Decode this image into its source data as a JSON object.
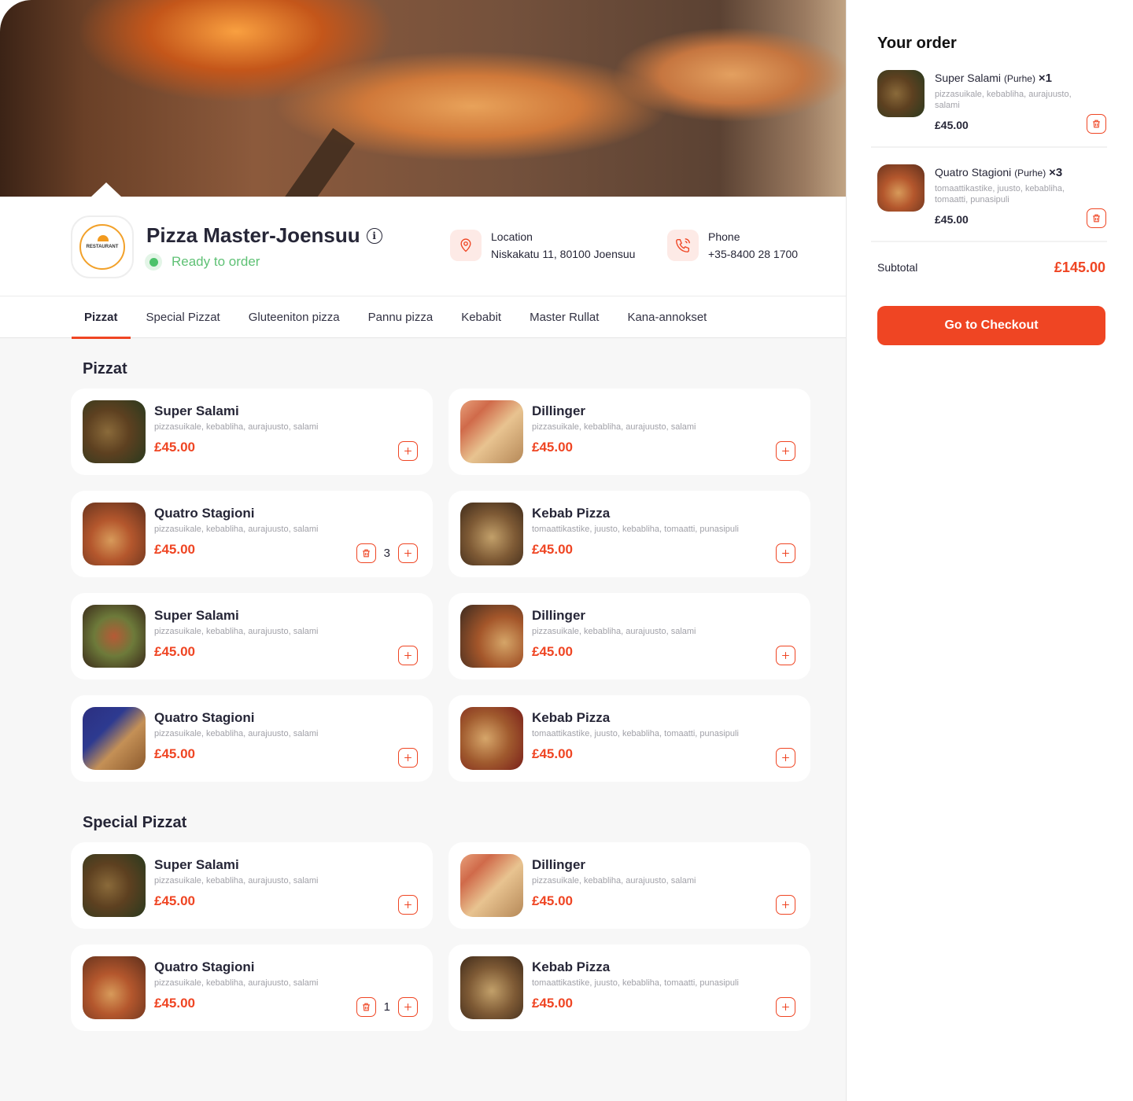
{
  "restaurant": {
    "name": "Pizza Master-Joensuu",
    "logo_text": "RESTAURANT",
    "status": "Ready to order",
    "location_label": "Location",
    "location_value": "Niskakatu 11, 80100 Joensuu",
    "phone_label": "Phone",
    "phone_value": "+35-8400  28  1700"
  },
  "tabs": [
    {
      "label": "Pizzat",
      "active": true
    },
    {
      "label": "Special Pizzat"
    },
    {
      "label": "Gluteeniton pizza"
    },
    {
      "label": "Pannu pizza"
    },
    {
      "label": "Kebabit"
    },
    {
      "label": "Master Rullat"
    },
    {
      "label": "Kana-annokset"
    }
  ],
  "sections": [
    {
      "title": "Pizzat",
      "items": [
        {
          "name": "Super Salami",
          "desc": "pizzasuikale, kebabliha, aurajuusto, salami",
          "price": "£45.00",
          "qty": null
        },
        {
          "name": "Dillinger",
          "desc": "pizzasuikale, kebabliha, aurajuusto, salami",
          "price": "£45.00",
          "qty": null
        },
        {
          "name": "Quatro Stagioni",
          "desc": "pizzasuikale, kebabliha, aurajuusto, salami",
          "price": "£45.00",
          "qty": "3"
        },
        {
          "name": "Kebab Pizza",
          "desc": "tomaattikastike, juusto, kebabliha, tomaatti, punasipuli",
          "price": "£45.00",
          "qty": null
        },
        {
          "name": "Super Salami",
          "desc": "pizzasuikale, kebabliha, aurajuusto, salami",
          "price": "£45.00",
          "qty": null
        },
        {
          "name": "Dillinger",
          "desc": "pizzasuikale, kebabliha, aurajuusto, salami",
          "price": "£45.00",
          "qty": null
        },
        {
          "name": "Quatro Stagioni",
          "desc": "pizzasuikale, kebabliha, aurajuusto, salami",
          "price": "£45.00",
          "qty": null
        },
        {
          "name": "Kebab Pizza",
          "desc": "tomaattikastike, juusto, kebabliha, tomaatti, punasipuli",
          "price": "£45.00",
          "qty": null
        }
      ]
    },
    {
      "title": "Special Pizzat",
      "items": [
        {
          "name": "Super Salami",
          "desc": "pizzasuikale, kebabliha, aurajuusto, salami",
          "price": "£45.00",
          "qty": null
        },
        {
          "name": "Dillinger",
          "desc": "pizzasuikale, kebabliha, aurajuusto, salami",
          "price": "£45.00",
          "qty": null
        },
        {
          "name": "Quatro Stagioni",
          "desc": "pizzasuikale, kebabliha, aurajuusto, salami",
          "price": "£45.00",
          "qty": "1"
        },
        {
          "name": "Kebab Pizza",
          "desc": "tomaattikastike, juusto, kebabliha, tomaatti, punasipuli",
          "price": "£45.00",
          "qty": null
        }
      ]
    }
  ],
  "order": {
    "title": "Your order",
    "items": [
      {
        "name": "Super Salami",
        "variant": "(Purhe)",
        "mult": "×1",
        "desc": "pizzasuikale, kebabliha, aurajuusto, salami",
        "price": "£45.00"
      },
      {
        "name": "Quatro Stagioni",
        "variant": "(Purhe)",
        "mult": "×3",
        "desc": "tomaattikastike, juusto, kebabliha, tomaatti, punasipuli",
        "price": "£45.00"
      }
    ],
    "subtotal_label": "Subtotal",
    "subtotal_value": "£145.00",
    "checkout_label": "Go to Checkout"
  },
  "colors": {
    "accent": "#ef4523",
    "status_green": "#4cc26a",
    "text_dark": "#262637",
    "text_muted": "#a1a1a8"
  }
}
